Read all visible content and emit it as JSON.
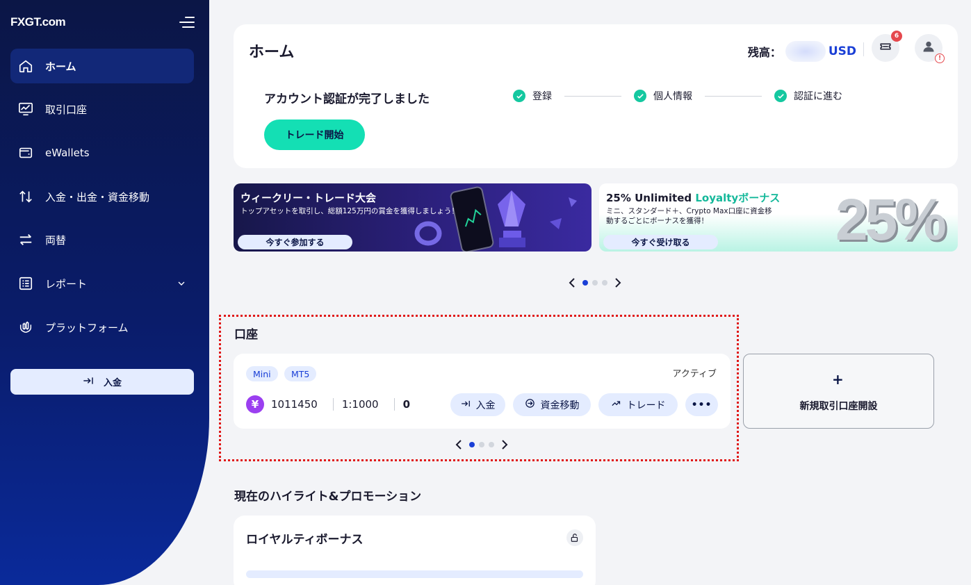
{
  "brand": {
    "logo_text": "FXGT.com"
  },
  "sidebar": {
    "items": [
      {
        "label": "ホーム",
        "icon": "home-icon"
      },
      {
        "label": "取引口座",
        "icon": "chart-monitor-icon"
      },
      {
        "label": "eWallets",
        "icon": "wallet-icon"
      },
      {
        "label": "入金・出金・資金移動",
        "icon": "transfer-arrows-icon"
      },
      {
        "label": "両替",
        "icon": "exchange-icon"
      },
      {
        "label": "レポート",
        "icon": "report-list-icon"
      },
      {
        "label": "プラットフォーム",
        "icon": "platform-icon"
      }
    ],
    "deposit_label": "入金"
  },
  "header": {
    "title": "ホーム",
    "balance_label": "残高：",
    "balance_currency": "USD",
    "notification_count": "6",
    "profile_warning": "!"
  },
  "verification": {
    "title": "アカウント認証が完了しました",
    "steps": [
      "登録",
      "個人情報",
      "認証に進む"
    ],
    "trade_start_label": "トレード開始"
  },
  "banners": [
    {
      "title": "ウィークリー・トレード大会",
      "subtitle": "トップアセットを取引し、総額125万円の賞金を獲得しましょう！",
      "cta": "今すぐ参加する"
    },
    {
      "title_pre": "25% Unlimited ",
      "title_highlight": "Loyaltyボーナス",
      "subtitle_line1": "ミニ、スタンダード＋、Crypto Max口座に資金移",
      "subtitle_line2": "動するごとにボーナスを獲得！",
      "cta": "今すぐ受け取る",
      "graphic_text": "25%"
    }
  ],
  "accounts": {
    "section_title": "口座",
    "card": {
      "tags": [
        "Mini",
        "MT5"
      ],
      "status": "アクティブ",
      "currency_symbol": "¥",
      "account_number": "1011450",
      "leverage": "1:1000",
      "balance": "0",
      "actions": {
        "deposit": "入金",
        "transfer": "資金移動",
        "trade": "トレード",
        "more": "•••"
      }
    },
    "new_account_label": "新規取引口座開設",
    "new_account_plus": "+"
  },
  "promotions": {
    "section_title": "現在のハイライト&プロモーション",
    "card_title": "ロイヤルティボーナス"
  }
}
